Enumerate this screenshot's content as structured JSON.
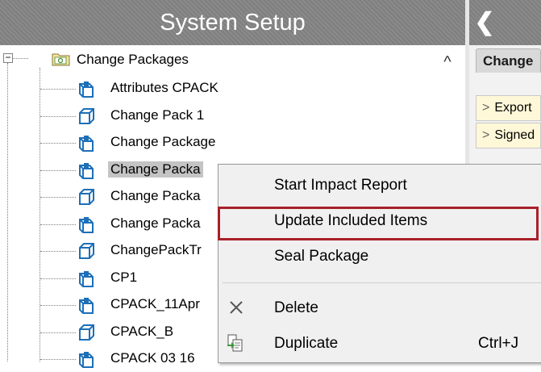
{
  "left_panel": {
    "title": "System Setup"
  },
  "tree": {
    "root_label": "Change Packages",
    "root_toggle": "−",
    "items": [
      {
        "label": "Attributes CPACK",
        "icon": "change-package-blue-icon"
      },
      {
        "label": "Change Pack 1",
        "icon": "change-package-cube-icon"
      },
      {
        "label": "Change Package",
        "icon": "change-package-blue-icon"
      },
      {
        "label": "Change Packa",
        "icon": "change-package-blue-icon"
      },
      {
        "label": "Change Packa",
        "icon": "change-package-cube-icon"
      },
      {
        "label": "Change Packa",
        "icon": "change-package-blue-icon"
      },
      {
        "label": "ChangePackTr",
        "icon": "change-package-cube-icon"
      },
      {
        "label": "CP1",
        "icon": "change-package-blue-icon"
      },
      {
        "label": "CPACK_11Apr",
        "icon": "change-package-blue-icon"
      },
      {
        "label": "CPACK_B",
        "icon": "change-package-cube-icon"
      },
      {
        "label": "CPACK 03 16",
        "icon": "change-package-blue-icon"
      }
    ]
  },
  "right_panel": {
    "back_label": "❮",
    "tab_label": "Change",
    "rows": [
      {
        "chevron": ">",
        "label": "Export"
      },
      {
        "chevron": ">",
        "label": "Signed"
      }
    ],
    "row_color": "#fff8d8"
  },
  "context_menu": {
    "items": [
      {
        "label": "Start Impact Report",
        "shortcut": "",
        "icon": ""
      },
      {
        "label": "Update Included Items",
        "shortcut": "",
        "icon": "",
        "highlighted": true
      },
      {
        "label": "Seal Package",
        "shortcut": "",
        "icon": ""
      },
      {
        "label": "Delete",
        "shortcut": "",
        "icon": "delete-x-icon"
      },
      {
        "label": "Duplicate",
        "shortcut": "Ctrl+J",
        "icon": "duplicate-icon"
      }
    ],
    "highlight_color": "#a8202a"
  }
}
